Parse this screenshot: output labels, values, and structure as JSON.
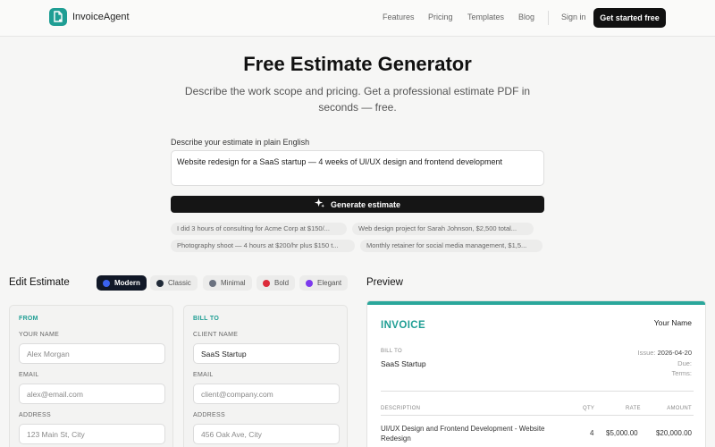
{
  "nav": {
    "brand": "InvoiceAgent",
    "links": [
      "Features",
      "Pricing",
      "Templates",
      "Blog"
    ],
    "signin": "Sign in",
    "cta": "Get started free"
  },
  "hero": {
    "title": "Free Estimate Generator",
    "subtitle": "Describe the work scope and pricing. Get a professional estimate PDF in seconds — free."
  },
  "prompt": {
    "label": "Describe your estimate in plain English",
    "value": "Website redesign for a SaaS startup — 4 weeks of UI/UX design and frontend development",
    "button": "Generate estimate"
  },
  "examples": [
    "I did 3 hours of consulting for Acme Corp at $150/...",
    "Web design project for Sarah Johnson, $2,500 total...",
    "Photography shoot — 4 hours at $200/hr plus $150 t...",
    "Monthly retainer for social media management, $1,5..."
  ],
  "editor": {
    "title": "Edit Estimate",
    "templates": [
      {
        "label": "Modern",
        "color": "#3b63f0"
      },
      {
        "label": "Classic",
        "color": "#1f2937"
      },
      {
        "label": "Minimal",
        "color": "#6b7280"
      },
      {
        "label": "Bold",
        "color": "#dc2b3a"
      },
      {
        "label": "Elegant",
        "color": "#7c3aed"
      }
    ],
    "from": {
      "heading": "FROM",
      "name_label": "YOUR NAME",
      "name_placeholder": "Alex Morgan",
      "email_label": "EMAIL",
      "email_placeholder": "alex@email.com",
      "address_label": "ADDRESS",
      "address_placeholder": "123 Main St, City"
    },
    "billto": {
      "heading": "BILL TO",
      "name_label": "CLIENT NAME",
      "name_value": "SaaS Startup",
      "email_label": "EMAIL",
      "email_placeholder": "client@company.com",
      "address_label": "ADDRESS",
      "address_placeholder": "456 Oak Ave, City"
    }
  },
  "preview": {
    "title": "Preview",
    "heading": "INVOICE",
    "your_name": "Your Name",
    "billto_label": "BILL TO",
    "client": "SaaS Startup",
    "issue_label": "Issue:",
    "issue_value": "2026-04-20",
    "due_label": "Due:",
    "terms_label": "Terms:",
    "columns": {
      "desc": "DESCRIPTION",
      "qty": "QTY",
      "rate": "RATE",
      "amount": "AMOUNT"
    },
    "rows": [
      {
        "desc": "UI/UX Design and Frontend Development - Website Redesign",
        "qty": "4",
        "rate": "$5,000.00",
        "amount": "$20,000.00"
      }
    ]
  },
  "colors": {
    "accent": "#1f9e94",
    "dark": "#111111"
  }
}
